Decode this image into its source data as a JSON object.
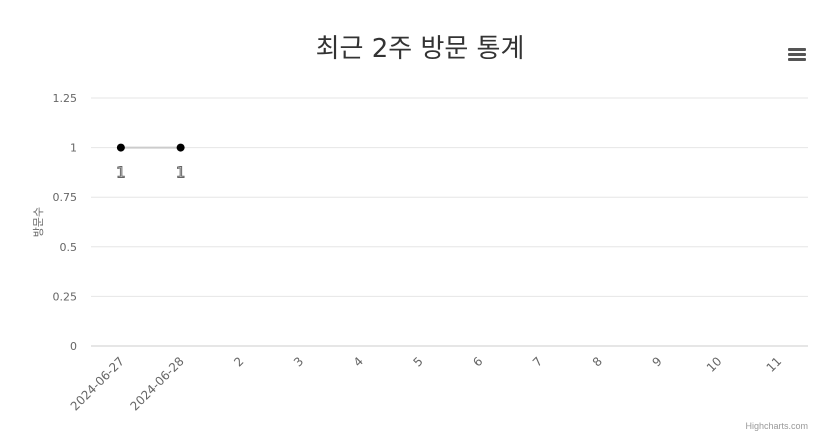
{
  "chart_data": {
    "type": "line",
    "title": "최근 2주 방문 통계",
    "ylabel": "방문수",
    "xlabel": "",
    "categories": [
      "2024-06-27",
      "2024-06-28",
      "2",
      "3",
      "4",
      "5",
      "6",
      "7",
      "8",
      "9",
      "10",
      "11"
    ],
    "series": [
      {
        "values": [
          1,
          1
        ],
        "data_labels": [
          "1",
          "1"
        ]
      }
    ],
    "ylim": [
      0,
      1.25
    ],
    "yticks": [
      "0",
      "0.25",
      "0.5",
      "0.75",
      "1",
      "1.25"
    ],
    "grid": true,
    "line_color": "#cccccc",
    "marker_color": "#000000"
  },
  "ui": {
    "menu_icon": "hamburger-menu-icon",
    "credits": "Highcharts.com"
  }
}
